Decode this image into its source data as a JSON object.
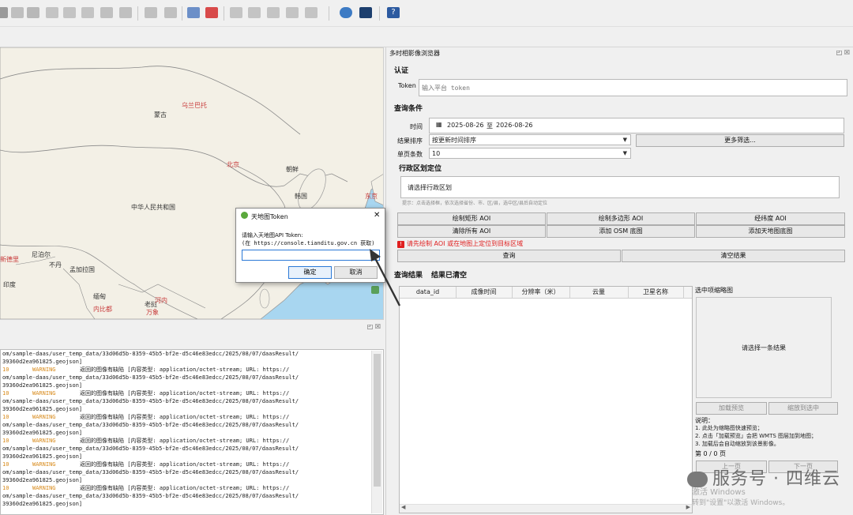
{
  "dock": {
    "title": "多时相影像浏览器",
    "auth": {
      "title": "认证",
      "token_label": "Token",
      "token_placeholder": "输入平台 token"
    },
    "query": {
      "title": "查询条件",
      "time_label": "时间",
      "start_date": "2025-08-26",
      "to_text": "至",
      "end_date": "2026-08-26",
      "sort_label": "结果排序",
      "sort_value": "按更新时间排序",
      "more_filter": "更多筛选...",
      "page_size_label": "单页条数",
      "page_size_value": "10"
    },
    "region": {
      "title": "行政区划定位",
      "placeholder": "请选择行政区划",
      "hint": "提示：点击选择框，依次选择省份、市、区/县，选中区/县后自动定位"
    },
    "aoi_buttons": [
      "绘制矩形 AOI",
      "绘制多边形 AOI",
      "经纬度 AOI",
      "清除所有 AOI",
      "添加 OSM 底图",
      "添加天地图底图"
    ],
    "warning": "请先绘制 AOI 或在地图上定位到目标区域",
    "query_button": "查询",
    "clear_button": "清空结果",
    "results": {
      "title": "查询结果",
      "status": "结果已清空",
      "columns": [
        "data_id",
        "成像时间",
        "分辨率（米）",
        "云量",
        "卫星名称"
      ]
    },
    "preview": {
      "title": "选中项缩略图",
      "placeholder": "请选择一条结果",
      "load_btn": "加载预览",
      "zoom_btn": "缩放到选中",
      "notes_title": "说明：",
      "notes": [
        "1. 此处为缩略图快速预览；",
        "2. 点击「加载预览」会把 WMTS 图层加到地图；",
        "3. 加载后会自动缩放到该景影像。"
      ],
      "page_info": "第 0 / 0 页",
      "prev": "上一页",
      "next": "下一页"
    }
  },
  "dialog": {
    "title": "天地图Token",
    "line1": "请输入天地图API Token:",
    "line2": "(在 https://console.tianditu.gov.cn 获取)",
    "ok": "确定",
    "cancel": "取消"
  },
  "map": {
    "labels": {
      "ulanbator": "乌兰巴托",
      "mongolia": "蒙古",
      "beijing": "北京",
      "korea_n": "朝鲜",
      "korea": "韩国",
      "china": "中华人民共和国",
      "tokyo": "东京",
      "nepal": "尼泊尔",
      "delhi": "新德里",
      "bhutan": "不丹",
      "bangladesh": "孟加拉国",
      "india": "印度",
      "myanmar": "缅甸",
      "laos": "老挝",
      "vientiane": "万象",
      "hanoi": "河内",
      "naypyidaw": "内比都"
    }
  },
  "log": {
    "lines": [
      {
        "type": "path",
        "text": "om/sample-daas/user_temp_data/33d06d5b-8359-45b5-bf2e-d5c46e83edcc/2025/08/07/daasResult/"
      },
      {
        "type": "path",
        "text": "39360d2ea961825.geojson]"
      },
      {
        "type": "warn",
        "time": "10",
        "level": "WARNING",
        "msg": "返回的图像有缺陷 [内容类型: application/octet-stream; URL: https://"
      },
      {
        "type": "path",
        "text": "om/sample-daas/user_temp_data/33d06d5b-8359-45b5-bf2e-d5c46e83edcc/2025/08/07/daasResult/"
      },
      {
        "type": "path",
        "text": "39360d2ea961825.geojson]"
      },
      {
        "type": "warn",
        "time": "10",
        "level": "WARNING",
        "msg": "返回的图像有缺陷 [内容类型: application/octet-stream; URL: https://"
      },
      {
        "type": "path",
        "text": "om/sample-daas/user_temp_data/33d06d5b-8359-45b5-bf2e-d5c46e83edcc/2025/08/07/daasResult/"
      },
      {
        "type": "path",
        "text": "39360d2ea961825.geojson]"
      },
      {
        "type": "warn",
        "time": "10",
        "level": "WARNING",
        "msg": "返回的图像有缺陷 [内容类型: application/octet-stream; URL: https://"
      },
      {
        "type": "path",
        "text": "om/sample-daas/user_temp_data/33d06d5b-8359-45b5-bf2e-d5c46e83edcc/2025/08/07/daasResult/"
      },
      {
        "type": "path",
        "text": "39360d2ea961825.geojson]"
      },
      {
        "type": "warn",
        "time": "10",
        "level": "WARNING",
        "msg": "返回的图像有缺陷 [内容类型: application/octet-stream; URL: https://"
      },
      {
        "type": "path",
        "text": "om/sample-daas/user_temp_data/33d06d5b-8359-45b5-bf2e-d5c46e83edcc/2025/08/07/daasResult/"
      },
      {
        "type": "path",
        "text": "39360d2ea961825.geojson]"
      },
      {
        "type": "warn",
        "time": "10",
        "level": "WARNING",
        "msg": "返回的图像有缺陷 [内容类型: application/octet-stream; URL: https://"
      },
      {
        "type": "path",
        "text": "om/sample-daas/user_temp_data/33d06d5b-8359-45b5-bf2e-d5c46e83edcc/2025/08/07/daasResult/"
      },
      {
        "type": "path",
        "text": "39360d2ea961825.geojson]"
      },
      {
        "type": "warn",
        "time": "10",
        "level": "WARNING",
        "msg": "返回的图像有缺陷 [内容类型: application/octet-stream; URL: https://"
      },
      {
        "type": "path",
        "text": "om/sample-daas/user_temp_data/33d06d5b-8359-45b5-bf2e-d5c46e83edcc/2025/08/07/daasResult/"
      },
      {
        "type": "path",
        "text": "39360d2ea961825.geojson]"
      }
    ]
  },
  "overlay": {
    "watermark": "服务号 · 四维云",
    "windows_line1": "激活 Windows",
    "windows_line2": "转到\"设置\"以激活 Windows。"
  },
  "colors": {
    "warning_red": "#e02020",
    "map_sea": "#a8d6f0",
    "map_land": "#f3f0e6",
    "accent_blue": "#1a6fc4"
  }
}
